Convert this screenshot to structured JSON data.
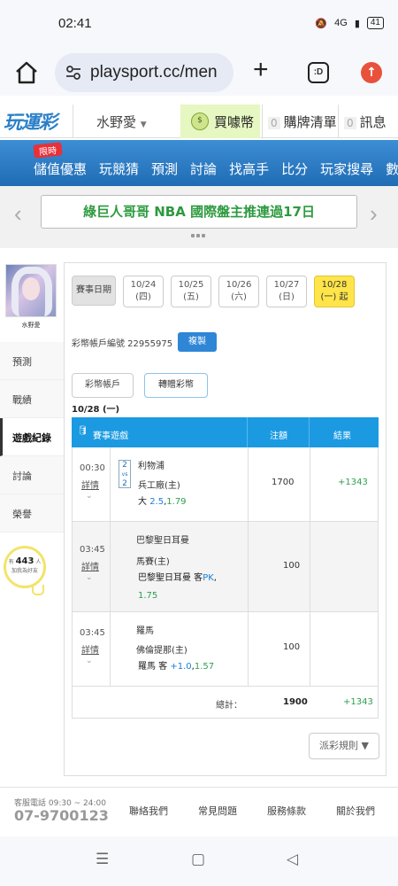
{
  "status": {
    "time": "02:41",
    "network": "4G",
    "battery": "41"
  },
  "browser": {
    "url": "playsport.cc/men",
    "tabs_label": ":D"
  },
  "header": {
    "logo": "玩運彩",
    "user_label": "水野愛",
    "buy_label": "買噱幣",
    "cart_count": "0",
    "cart_label": "購牌清單",
    "msg_count": "0",
    "msg_label": "訊息"
  },
  "nav": {
    "badge": "限時",
    "items": [
      "儲值優惠",
      "玩競猜",
      "預測",
      "討論",
      "找高手",
      "比分",
      "玩家搜尋",
      "數據"
    ]
  },
  "banner": {
    "text": "綠巨人哥哥 NBA 國際盤主推連過17日"
  },
  "sidebar": {
    "username": "水野愛",
    "items": [
      "預測",
      "戰績",
      "遊戲紀錄",
      "討論",
      "榮譽"
    ],
    "fans_prefix": "有",
    "fans_count": "443",
    "fans_unit": "人",
    "fans_suffix": "加我為好友"
  },
  "dates": {
    "label": "賽事日期",
    "items": [
      {
        "date": "10/24",
        "day": "(四)"
      },
      {
        "date": "10/25",
        "day": "(五)"
      },
      {
        "date": "10/26",
        "day": "(六)"
      },
      {
        "date": "10/27",
        "day": "(日)"
      },
      {
        "date": "10/28",
        "day": "(一) 起"
      }
    ]
  },
  "account": {
    "text": "彩幣帳戶編號 22955975",
    "copy_label": "複製"
  },
  "subtabs": [
    "彩幣帳戶",
    "轉贈彩幣"
  ],
  "date_heading": "10/28 (一)",
  "table": {
    "headers": [
      "賽事遊戲",
      "注額",
      "結果"
    ],
    "detail_label": "詳情",
    "rows": [
      {
        "time": "00:30",
        "vs_top": "2",
        "vs_mid": "vs",
        "vs_bot": "2",
        "team1": "利物浦",
        "team2": "兵工廠(主)",
        "pick": "大",
        "pick_line": "2.5",
        "odds": "1.79",
        "amount": "1700",
        "result": "+1343"
      },
      {
        "time": "03:45",
        "team1": "巴黎聖日耳曼",
        "team2": "馬賽(主)",
        "pick": "巴黎聖日耳曼 客",
        "pick_line": "PK",
        "odds": "1.75",
        "amount": "100",
        "result": ""
      },
      {
        "time": "03:45",
        "team1": "羅馬",
        "team2": "佛倫提那(主)",
        "pick": "羅馬 客",
        "pick_line": "+1.0",
        "odds": "1.57",
        "amount": "100",
        "result": ""
      }
    ],
    "total_label": "總計：",
    "total_amount": "1900",
    "total_result": "+1343"
  },
  "rules_label": "派彩規則 ▼",
  "footer": {
    "service": "客服電話 09:30 ~ 24:00",
    "phone": "07-9700123",
    "links": [
      "聯絡我們",
      "常見問題",
      "服務條款",
      "關於我們"
    ]
  },
  "colors": {
    "accent": "#1b9ae2",
    "nav": "#1f6cb5",
    "positive": "#2e9e4f",
    "active_date": "#ffe54a"
  }
}
